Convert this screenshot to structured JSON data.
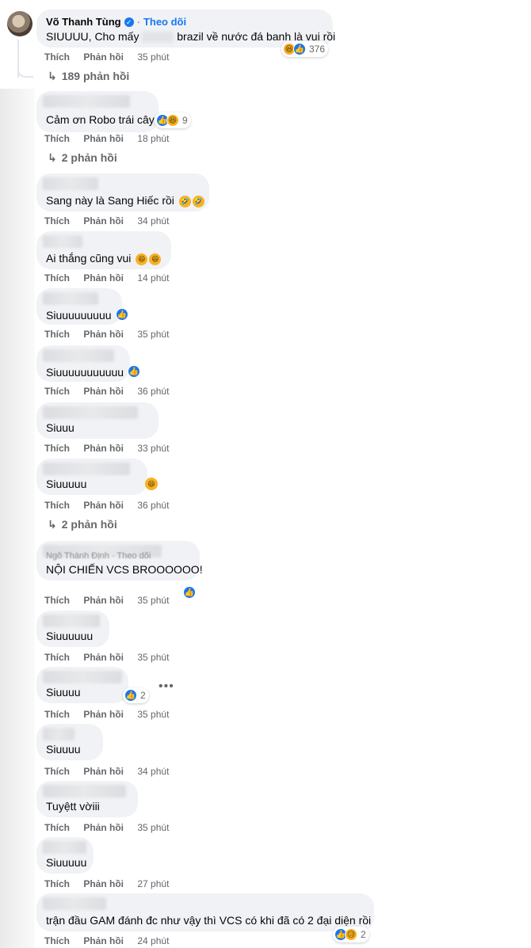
{
  "top_comment": {
    "author": "Võ Thanh Tùng",
    "follow_label": "Theo dõi",
    "text_start": "SIUUUU, Cho mấy",
    "text_end": "brazil về nước đá banh là vui rồi",
    "reaction_count": "376",
    "like_label": "Thích",
    "reply_label": "Phản hồi",
    "time": "35 phút",
    "replies_label": "189 phản hồi"
  },
  "comments": [
    {
      "text": "Cảm ơn Robo trái cây",
      "reaction_count": "9",
      "time": "18 phút",
      "replies_label": "2 phản hồi"
    },
    {
      "text": "Sang này là Sang Hiếc rồi",
      "time": "34 phút"
    },
    {
      "text": "Ai thắng cũng vui",
      "time": "14 phút"
    },
    {
      "text": "Siuuuuuuuuu",
      "time": "35 phút"
    },
    {
      "text": "Siuuuuuuuuuuu",
      "time": "36 phút"
    },
    {
      "text": "Siuuu",
      "time": "33 phút"
    },
    {
      "text": "Siuuuuu",
      "time": "36 phút",
      "replies_label": "2 phản hồi"
    },
    {
      "partial_name": "Ngô Thành Định · Theo dõi",
      "text": "NỘI CHIẾN VCS BROOOOOO!",
      "time": "35 phút"
    },
    {
      "text": "Siuuuuuu",
      "time": "35 phút"
    },
    {
      "text": "Siuuuu",
      "reaction_count": "2",
      "time": "35 phút"
    },
    {
      "text": "Siuuuu",
      "time": "34 phút"
    },
    {
      "text": "Tuyệtt vờiii",
      "time": "35 phút"
    },
    {
      "text": "Siuuuuu",
      "time": "27 phút"
    },
    {
      "text": "trận đầu GAM đánh đc như vậy thì VCS có khi đã có 2 đại diện rồi",
      "reaction_count": "2",
      "time": "24 phút"
    }
  ],
  "labels": {
    "like": "Thích",
    "reply": "Phản hồi"
  },
  "icons": {
    "like": "thumbs-up-icon",
    "haha": "haha-emoji-icon",
    "reply_arrow": "reply-arrow-icon",
    "more": "more-options-icon"
  },
  "colors": {
    "accent": "#1877f2",
    "bubble": "#f0f2f5",
    "meta": "#65676b"
  }
}
